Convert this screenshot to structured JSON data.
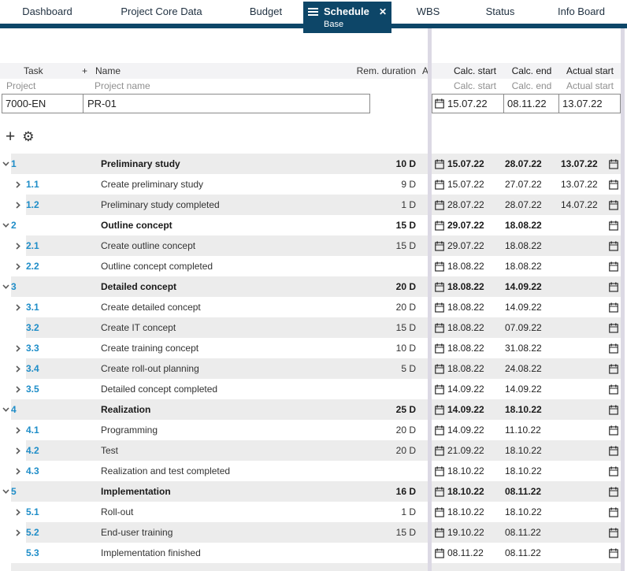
{
  "colors": {
    "accent_navy": "#0d4668",
    "task_number_blue": "#1e8dc8",
    "row_alt_bg": "#ececec",
    "divider": "#dcd9e4"
  },
  "icons": {
    "add": "+",
    "settings": "⚙",
    "close": "✕"
  },
  "tabs": {
    "items": [
      {
        "label": "Dashboard"
      },
      {
        "label": "Project Core Data"
      },
      {
        "label": "Budget"
      },
      {
        "label": "Schedule",
        "active": true,
        "sub_label": "Base"
      },
      {
        "label": "WBS"
      },
      {
        "label": "Status"
      },
      {
        "label": "Info Board"
      }
    ]
  },
  "table": {
    "left_headers": {
      "task": "Task",
      "plus": "+",
      "name": "Name",
      "rem_duration": "Rem. duration",
      "a_truncated": "A"
    },
    "left_subheaders": {
      "task": "Project",
      "name": "Project name"
    },
    "right_headers": [
      "Calc. start",
      "Calc. end",
      "Actual start"
    ],
    "right_subheaders": [
      "Calc. start",
      "Calc. end",
      "Actual start"
    ],
    "project_row": {
      "id": "7000-EN",
      "name": "PR-01",
      "calc_start": "15.07.22",
      "calc_end": "08.11.22",
      "actual_start": "13.07.22"
    }
  },
  "rows": [
    {
      "num": "1",
      "name": "Preliminary study",
      "dur": "10 D",
      "calc_start": "15.07.22",
      "calc_end": "28.07.22",
      "actual_start": "13.07.22",
      "expander": "down"
    },
    {
      "num": "1.1",
      "name": "Create preliminary study",
      "dur": "9 D",
      "calc_start": "15.07.22",
      "calc_end": "27.07.22",
      "actual_start": "13.07.22",
      "expander": "right"
    },
    {
      "num": "1.2",
      "name": "Preliminary study completed",
      "dur": "1 D",
      "calc_start": "28.07.22",
      "calc_end": "28.07.22",
      "actual_start": "14.07.22",
      "expander": "right"
    },
    {
      "num": "2",
      "name": "Outline concept",
      "dur": "15 D",
      "calc_start": "29.07.22",
      "calc_end": "18.08.22",
      "actual_start": "",
      "expander": "down"
    },
    {
      "num": "2.1",
      "name": "Create outline concept",
      "dur": "15 D",
      "calc_start": "29.07.22",
      "calc_end": "18.08.22",
      "actual_start": "",
      "expander": "right"
    },
    {
      "num": "2.2",
      "name": "Outline concept completed",
      "dur": "",
      "calc_start": "18.08.22",
      "calc_end": "18.08.22",
      "actual_start": "",
      "expander": "right"
    },
    {
      "num": "3",
      "name": "Detailed concept",
      "dur": "20 D",
      "calc_start": "18.08.22",
      "calc_end": "14.09.22",
      "actual_start": "",
      "expander": "down"
    },
    {
      "num": "3.1",
      "name": "Create detailed concept",
      "dur": "20 D",
      "calc_start": "18.08.22",
      "calc_end": "14.09.22",
      "actual_start": "",
      "expander": "right"
    },
    {
      "num": "3.2",
      "name": "Create IT concept",
      "dur": "15 D",
      "calc_start": "18.08.22",
      "calc_end": "07.09.22",
      "actual_start": "",
      "expander": "none"
    },
    {
      "num": "3.3",
      "name": "Create training concept",
      "dur": "10 D",
      "calc_start": "18.08.22",
      "calc_end": "31.08.22",
      "actual_start": "",
      "expander": "right"
    },
    {
      "num": "3.4",
      "name": "Create roll-out planning",
      "dur": "5 D",
      "calc_start": "18.08.22",
      "calc_end": "24.08.22",
      "actual_start": "",
      "expander": "right"
    },
    {
      "num": "3.5",
      "name": "Detailed concept completed",
      "dur": "",
      "calc_start": "14.09.22",
      "calc_end": "14.09.22",
      "actual_start": "",
      "expander": "right"
    },
    {
      "num": "4",
      "name": "Realization",
      "dur": "25 D",
      "calc_start": "14.09.22",
      "calc_end": "18.10.22",
      "actual_start": "",
      "expander": "down"
    },
    {
      "num": "4.1",
      "name": "Programming",
      "dur": "20 D",
      "calc_start": "14.09.22",
      "calc_end": "11.10.22",
      "actual_start": "",
      "expander": "right"
    },
    {
      "num": "4.2",
      "name": "Test",
      "dur": "20 D",
      "calc_start": "21.09.22",
      "calc_end": "18.10.22",
      "actual_start": "",
      "expander": "right"
    },
    {
      "num": "4.3",
      "name": "Realization and test completed",
      "dur": "",
      "calc_start": "18.10.22",
      "calc_end": "18.10.22",
      "actual_start": "",
      "expander": "right"
    },
    {
      "num": "5",
      "name": "Implementation",
      "dur": "16 D",
      "calc_start": "18.10.22",
      "calc_end": "08.11.22",
      "actual_start": "",
      "expander": "down"
    },
    {
      "num": "5.1",
      "name": "Roll-out",
      "dur": "1 D",
      "calc_start": "18.10.22",
      "calc_end": "18.10.22",
      "actual_start": "",
      "expander": "right"
    },
    {
      "num": "5.2",
      "name": "End-user training",
      "dur": "15 D",
      "calc_start": "19.10.22",
      "calc_end": "08.11.22",
      "actual_start": "",
      "expander": "right"
    },
    {
      "num": "5.3",
      "name": "Implementation finished",
      "dur": "",
      "calc_start": "08.11.22",
      "calc_end": "08.11.22",
      "actual_start": "",
      "expander": "none"
    }
  ]
}
